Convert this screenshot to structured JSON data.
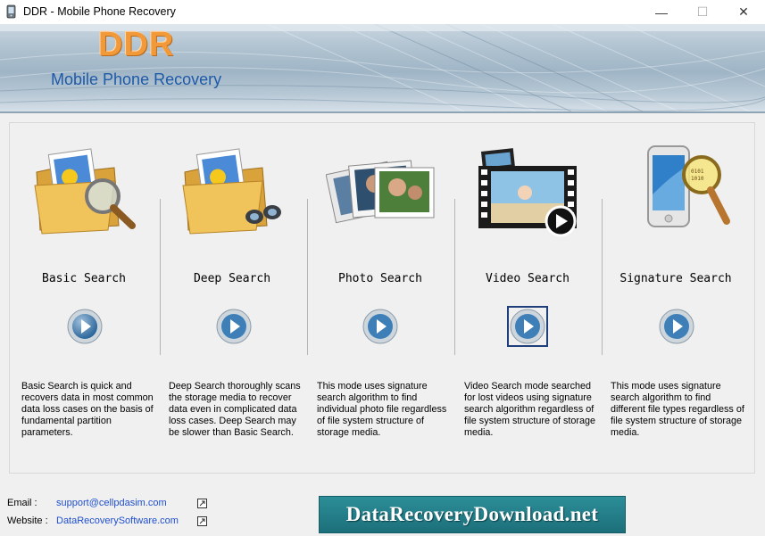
{
  "window": {
    "title": "DDR - Mobile Phone Recovery",
    "min_glyph": "—",
    "max_glyph": "☐",
    "close_glyph": "✕"
  },
  "banner": {
    "logo": "DDR",
    "subtitle": "Mobile Phone Recovery"
  },
  "modes": [
    {
      "title": "Basic Search",
      "icon": "folder-magnifier-icon",
      "description": "Basic Search is quick and recovers data in most common data loss cases on the basis of fundamental partition parameters."
    },
    {
      "title": "Deep Search",
      "icon": "folder-binoculars-icon",
      "description": "Deep Search thoroughly scans the storage media to recover data even in complicated data loss cases. Deep Search may be slower than Basic Search."
    },
    {
      "title": "Photo Search",
      "icon": "photos-stack-icon",
      "description": "This mode uses signature search algorithm to find individual photo file regardless of file system structure of storage media."
    },
    {
      "title": "Video Search",
      "icon": "film-strip-icon",
      "description": "Video Search mode searched for lost videos using signature search algorithm regardless of file system structure of storage media."
    },
    {
      "title": "Signature Search",
      "icon": "phone-magnifier-icon",
      "description": "This mode uses signature search algorithm to find different file types regardless of file system structure of storage media."
    }
  ],
  "selected_mode": "Video Search",
  "footer": {
    "email_label": "Email :",
    "email_value": "support@cellpdasim.com",
    "website_label": "Website :",
    "website_value": "DataRecoverySoftware.com",
    "promo": "DataRecoveryDownload.net"
  },
  "colors": {
    "logo": "#f29a3a",
    "subtitle": "#1f5aa8",
    "link": "#1f4fd0",
    "promo_bg": "#1c6f7a",
    "selected_border": "#1f3f7a"
  }
}
